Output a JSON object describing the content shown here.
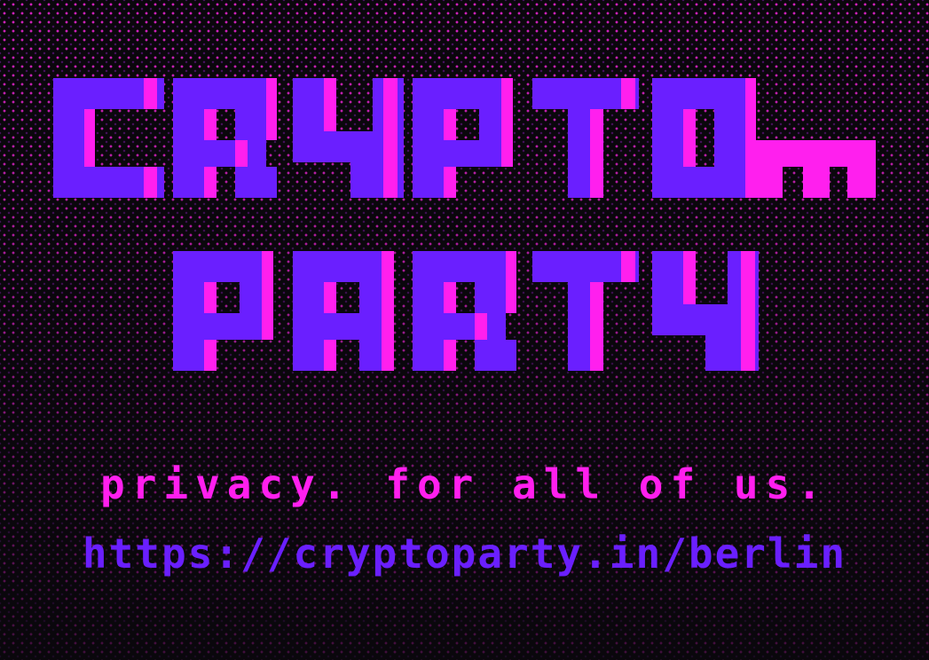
{
  "logo": {
    "line1": "CRYPTO",
    "line1_suffix": "m",
    "line2": "PARTY"
  },
  "tagline": "privacy. for all of us.",
  "url": "https://cryptoparty.in/berlin",
  "colors": {
    "background": "#0a070c",
    "dots": "#ff28e6",
    "logo_primary": "#6a1fff",
    "logo_secondary": "#ff1fee",
    "tagline": "#ff1fee",
    "url": "#6a1fff"
  }
}
